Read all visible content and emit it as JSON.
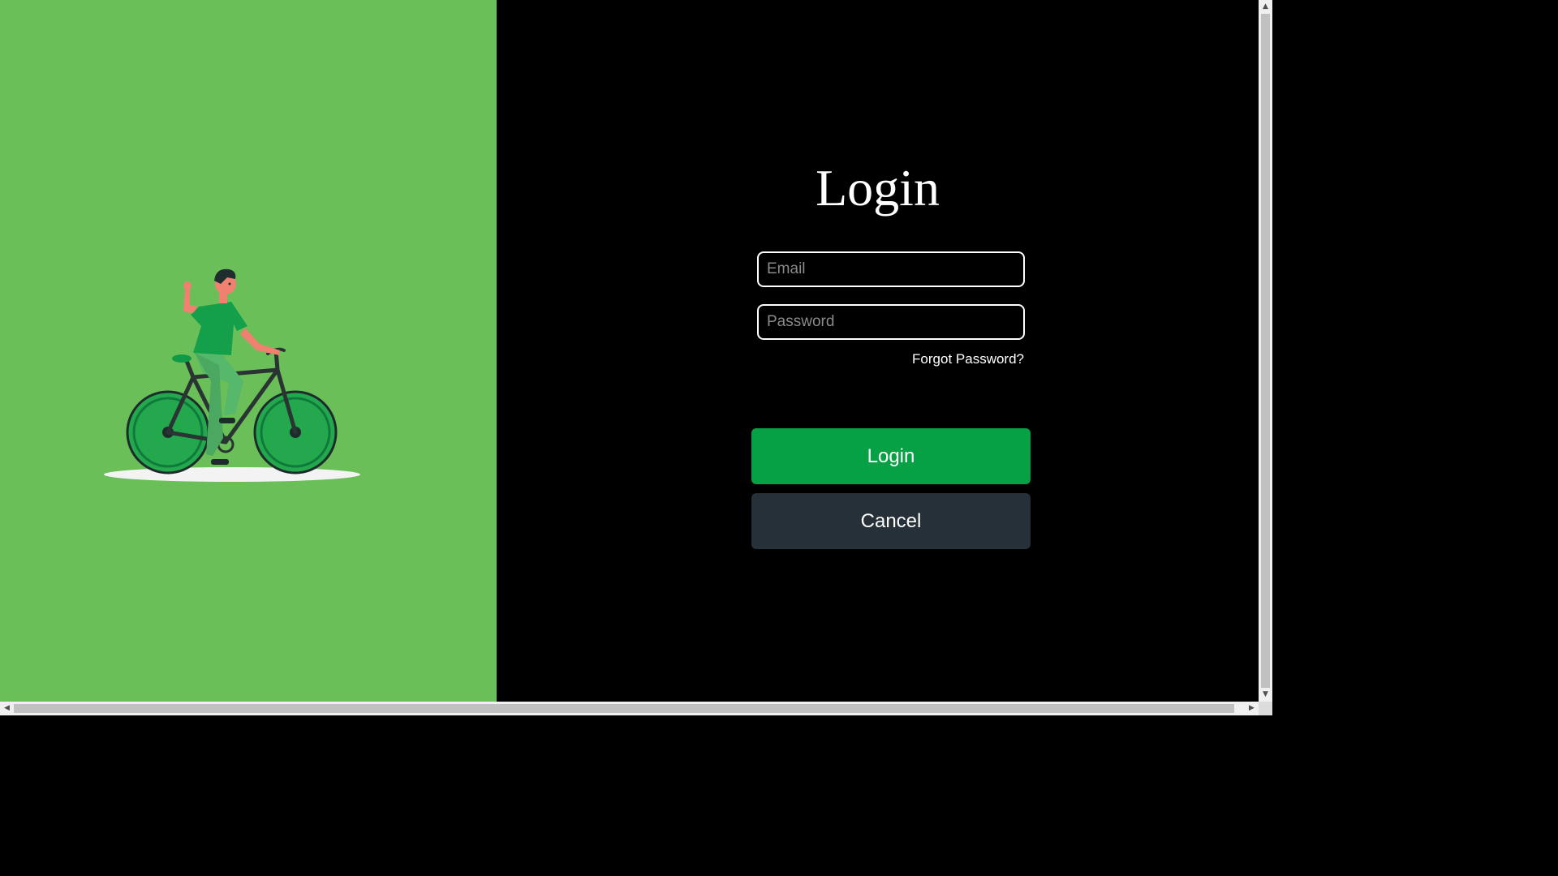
{
  "colors": {
    "left_panel": "#6abf58",
    "right_panel": "#000000",
    "login_button": "#06a045",
    "cancel_button": "#263038"
  },
  "illustration": {
    "icon": "person-riding-bicycle-illustration"
  },
  "login": {
    "title": "Login",
    "email_placeholder": "Email",
    "email_value": "",
    "password_placeholder": "Password",
    "password_value": "",
    "forgot_label": "Forgot Password?",
    "login_label": "Login",
    "cancel_label": "Cancel"
  },
  "scrollbars": {
    "up_icon": "▲",
    "down_icon": "▼",
    "left_icon": "◀",
    "right_icon": "▶"
  }
}
